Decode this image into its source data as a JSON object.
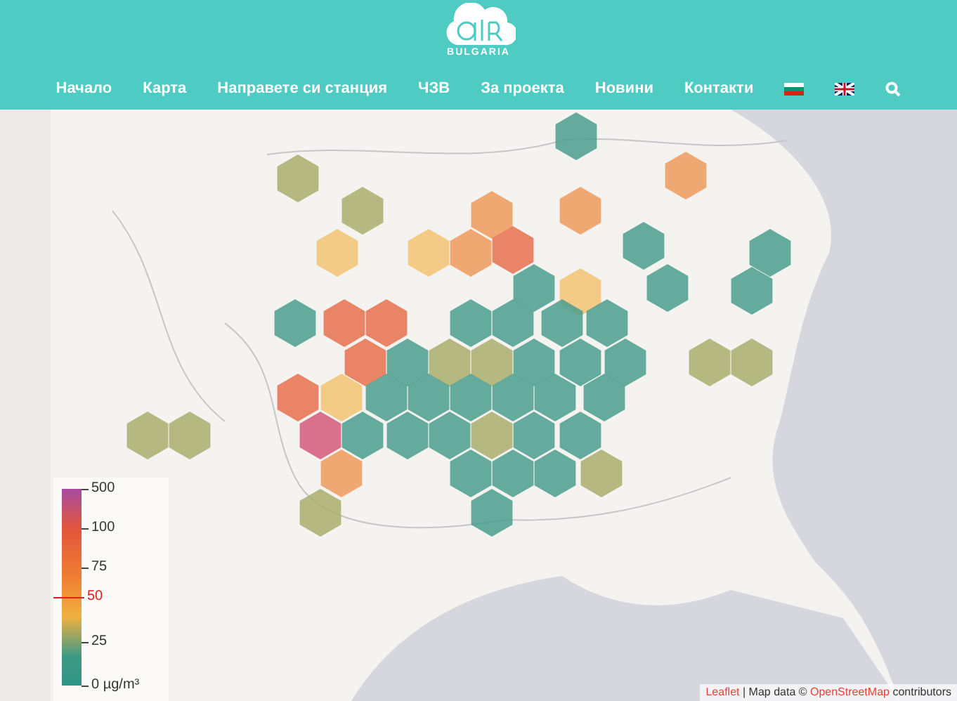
{
  "header": {
    "logo_text": "BULGARIA",
    "nav": [
      {
        "label": "Начало"
      },
      {
        "label": "Карта"
      },
      {
        "label": "Направете си станция"
      },
      {
        "label": "ЧЗВ"
      },
      {
        "label": "За проекта"
      },
      {
        "label": "Новини"
      },
      {
        "label": "Контакти"
      }
    ]
  },
  "legend": {
    "ticks": [
      {
        "label": "500",
        "highlighted": false
      },
      {
        "label": "100",
        "highlighted": false
      },
      {
        "label": "75",
        "highlighted": false
      },
      {
        "label": "50",
        "highlighted": true
      },
      {
        "label": "25",
        "highlighted": false
      },
      {
        "label": "0 µg/m³",
        "highlighted": false
      }
    ]
  },
  "attribution": {
    "link_1": "Leaflet",
    "text_1": " | Map data © ",
    "link_2": "OpenStreetMap",
    "text_2": " contributors"
  }
}
